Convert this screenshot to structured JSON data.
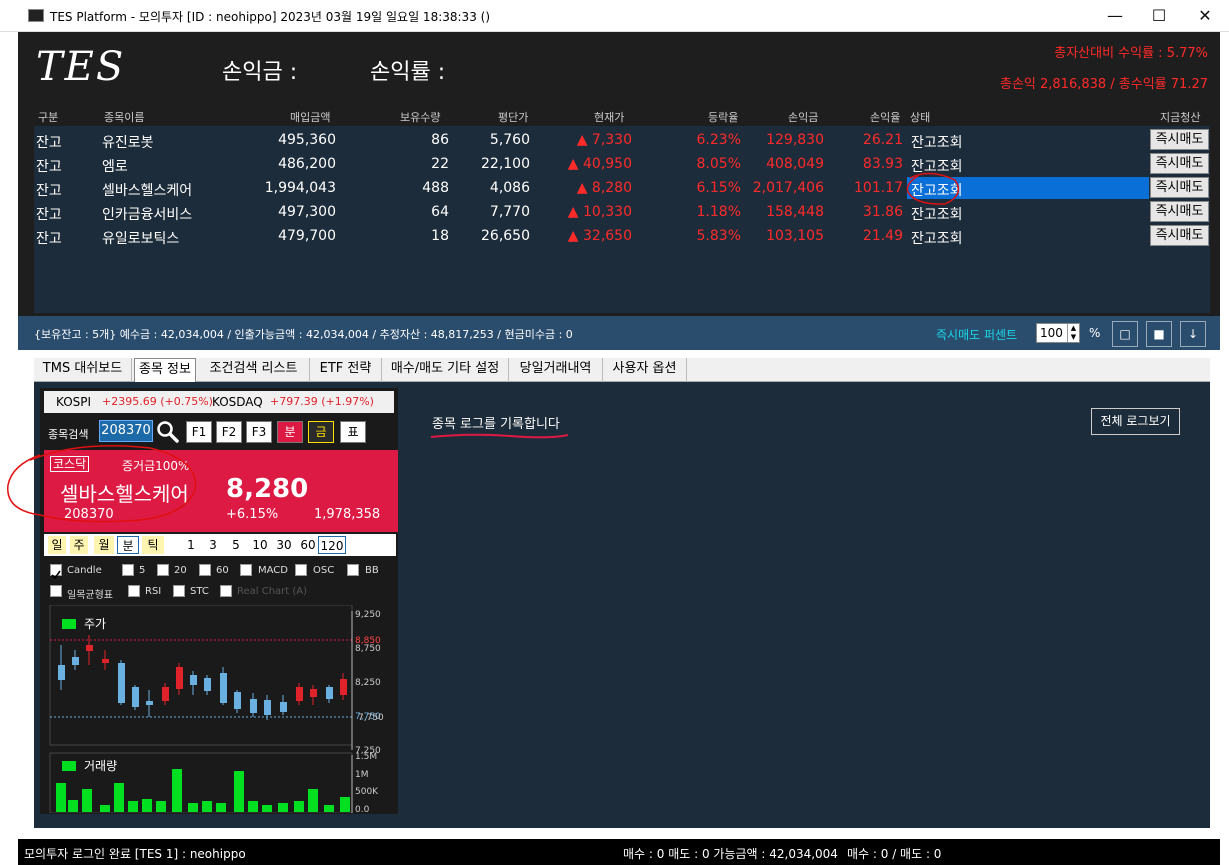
{
  "window": {
    "title": "TES Platform - 모의투자 [ID : neohippo] 2023년 03월 19일 일요일 18:38:33 ()",
    "minimize": "—",
    "maximize": "☐",
    "close": "✕"
  },
  "header": {
    "logo": "TES",
    "pl_amount_label": "손익금 :",
    "pl_rate_label": "손익률 :",
    "total_asset_return": "총자산대비 수익률 : 5.77%",
    "total_pl": "총손익 2,816,838 / 총수익률 71.27"
  },
  "table": {
    "headers": [
      "구분",
      "종목이름",
      "매입금액",
      "보유수량",
      "평단가",
      "현재가",
      "등락율",
      "손익금",
      "손익율",
      "상태",
      "지금청산"
    ],
    "rows": [
      {
        "type": "잔고",
        "name": "유진로봇",
        "buy": "495,360",
        "qty": "86",
        "avg": "5,760",
        "cur": "▲ 7,330",
        "rate": "6.23%",
        "pl": "129,830",
        "plr": "26.21",
        "status": "잔고조회",
        "btn": "즉시매도"
      },
      {
        "type": "잔고",
        "name": "엠로",
        "buy": "486,200",
        "qty": "22",
        "avg": "22,100",
        "cur": "▲ 40,950",
        "rate": "8.05%",
        "pl": "408,049",
        "plr": "83.93",
        "status": "잔고조회",
        "btn": "즉시매도"
      },
      {
        "type": "잔고",
        "name": "셀바스헬스케어",
        "buy": "1,994,043",
        "qty": "488",
        "avg": "4,086",
        "cur": "▲ 8,280",
        "rate": "6.15%",
        "pl": "2,017,406",
        "plr": "101.17",
        "status": "잔고조회",
        "btn": "즉시매도"
      },
      {
        "type": "잔고",
        "name": "인카금융서비스",
        "buy": "497,300",
        "qty": "64",
        "avg": "7,770",
        "cur": "▲ 10,330",
        "rate": "1.18%",
        "pl": "158,448",
        "plr": "31.86",
        "status": "잔고조회",
        "btn": "즉시매도"
      },
      {
        "type": "잔고",
        "name": "유일로보틱스",
        "buy": "479,700",
        "qty": "18",
        "avg": "26,650",
        "cur": "▲ 32,650",
        "rate": "5.83%",
        "pl": "103,105",
        "plr": "21.49",
        "status": "잔고조회",
        "btn": "즉시매도"
      }
    ]
  },
  "summary": {
    "text": "{보유잔고 : 5개}      예수금 : 42,034,004 / 인출가능금액 : 42,034,004 / 추정자산 : 48,817,253 / 현금미수금 : 0",
    "pct_label": "즉시매도 퍼센트",
    "pct_value": "100",
    "pct_sign": "%",
    "btn1": "□",
    "btn2": "■",
    "btn3": "↓"
  },
  "tabs": [
    "TMS 대쉬보드",
    "종목 정보",
    "조건검색 리스트",
    "ETF 전략",
    "매수/매도 기타 설정",
    "당일거래내역",
    "사용자 옵션"
  ],
  "index": {
    "kospi_label": "KOSPI",
    "kospi_value": "+2395.69 (+0.75%)",
    "kosdaq_label": "KOSDAQ",
    "kosdaq_value": "+797.39 (+1.97%)"
  },
  "search": {
    "label": "종목검색",
    "code": "208370",
    "buttons": [
      "F1",
      "F2",
      "F3",
      "분",
      "금",
      "표"
    ]
  },
  "stock": {
    "market": "코스닥",
    "margin": "증거금100%",
    "name": "셀바스헬스케어",
    "price": "8,280",
    "code": "208370",
    "change": "+6.15%",
    "volume": "1,978,358"
  },
  "period": {
    "types": [
      "일",
      "주",
      "월",
      "분",
      "틱"
    ],
    "minutes": [
      "1",
      "3",
      "5",
      "10",
      "30",
      "60",
      "120"
    ]
  },
  "indicators": {
    "row1": [
      "Candle",
      "5",
      "20",
      "60",
      "MACD",
      "OSC",
      "BB"
    ],
    "row2": [
      "일목균형표",
      "RSI",
      "STC",
      "Real Chart (A)"
    ]
  },
  "chart": {
    "price_legend": "주가",
    "volume_legend": "거래량",
    "price_ticks": [
      "9,250",
      "8,850",
      "8,750",
      "8,250",
      "7,750",
      "7,750",
      "7,250"
    ],
    "volume_ticks": [
      "1.5M",
      "1M",
      "500K",
      "0.0"
    ]
  },
  "log": {
    "message": "종목 로그를 기록합니다",
    "view_all": "전체 로그보기"
  },
  "status": {
    "login": "모의투자 로그인 완료 [TES 1] : neohippo",
    "orders": "매수 : 0 매도 : 0 가능금액 : 42,034,004",
    "counts": "매수 : 0 / 매도 : 0"
  },
  "colors": {
    "up_red": "#ff2a2a",
    "stock_box": "#dc1a43",
    "selection": "#0a6fd6",
    "pct_cyan": "#19d8e8"
  }
}
